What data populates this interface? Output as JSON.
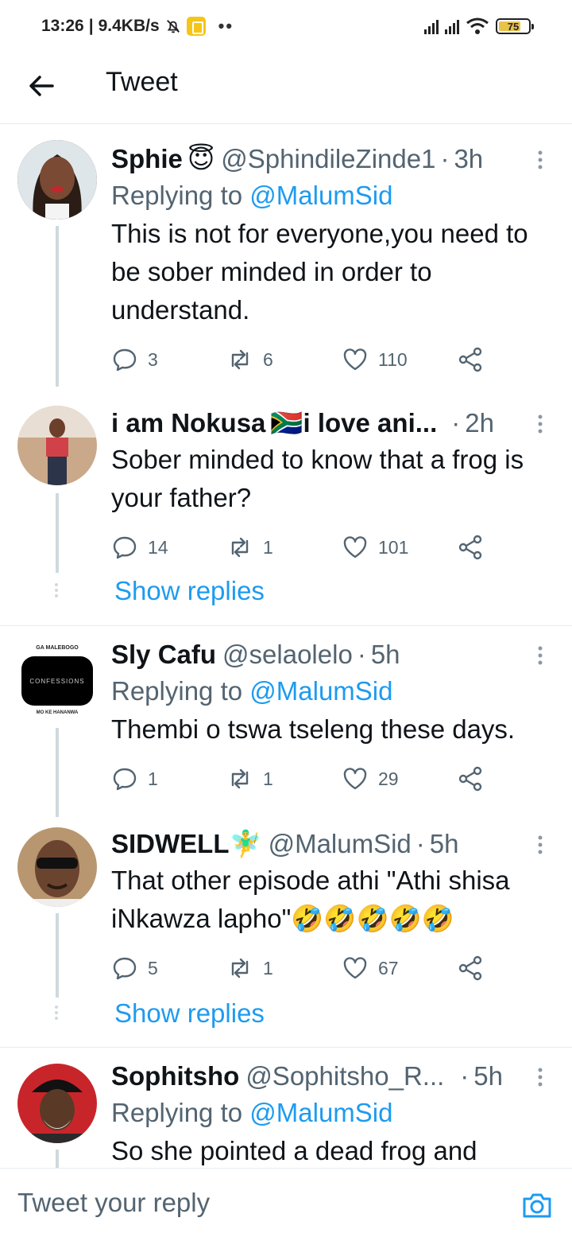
{
  "status_bar": {
    "time": "13:26",
    "speed": "9.4KB/s",
    "battery": "75",
    "battery_level": 0.75
  },
  "header": {
    "title": "Tweet"
  },
  "tweets": [
    {
      "name": "Sphie",
      "name_emoji": "😇",
      "handle": "@SphindileZinde1",
      "time": "3h",
      "replying_prefix": "Replying to",
      "replying_to": "@MalumSid",
      "text": "This is not for everyone,you need to be sober minded in order to understand.",
      "replies": "3",
      "retweets": "6",
      "likes": "110"
    },
    {
      "name": "i am Nokusa",
      "name_emoji": "🇿🇦",
      "name_suffix": "i love ani...",
      "time": "2h",
      "text": "Sober minded to know that a frog is your father?",
      "replies": "14",
      "retweets": "1",
      "likes": "101",
      "show_replies": "Show replies"
    },
    {
      "name": "Sly Cafu",
      "handle": "@selaolelo",
      "time": "5h",
      "replying_prefix": "Replying to",
      "replying_to": "@MalumSid",
      "text": "Thembi o tswa tseleng these days.",
      "replies": "1",
      "retweets": "1",
      "likes": "29",
      "avatar_text": {
        "top": "GA MALEBOGO",
        "middle": "CONFESSIONS",
        "bottom": "MO KE HANANWA"
      }
    },
    {
      "name": "SIDWELL",
      "name_emoji": "🧚‍♂️",
      "handle": "@MalumSid",
      "time": "5h",
      "text": "That other episode athi \"Athi shisa iNkawza lapho\"🤣🤣🤣🤣🤣",
      "replies": "5",
      "retweets": "1",
      "likes": "67",
      "show_replies": "Show replies"
    },
    {
      "name": "Sophitsho",
      "handle": "@Sophitsho_R...",
      "time": "5h",
      "replying_prefix": "Replying to",
      "replying_to": "@MalumSid",
      "text": "So she pointed a dead frog and"
    }
  ],
  "reply_bar": {
    "placeholder": "Tweet your reply"
  },
  "colors": {
    "accent": "#1d9bf0",
    "secondary_text": "#536471",
    "thread_line": "#cfd9de"
  }
}
